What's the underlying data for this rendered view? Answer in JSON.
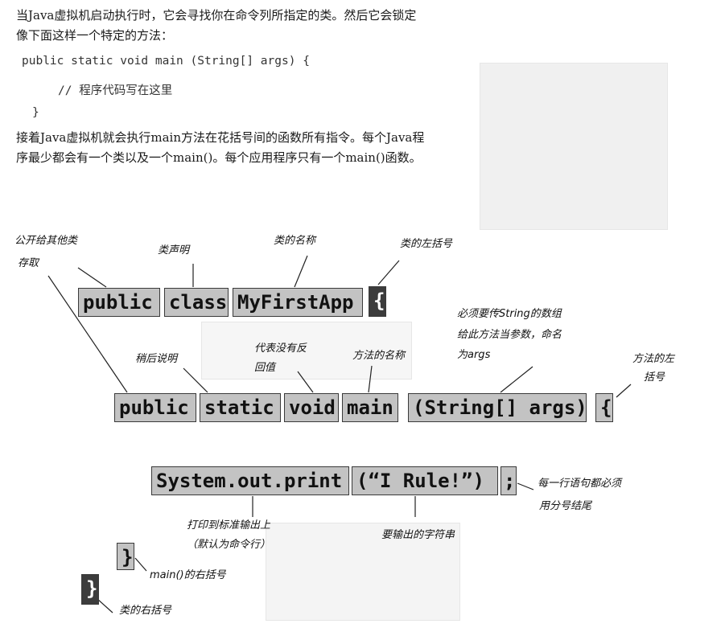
{
  "intro": {
    "line1": "当Java虚拟机启动执行时，它会寻找你在命令列所指定的类。然后它会锁定",
    "line2": "像下面这样一个特定的方法："
  },
  "code_sample": {
    "line1": "public static void main (String[] args) {",
    "line2": "// 程序代码写在这里",
    "line3": "}"
  },
  "outro": {
    "line1": "接着Java虚拟机就会执行main方法在花括号间的函数所有指令。每个Java程",
    "line2": "序最少都会有一个类以及一个main()。每个应用程序只有一个main()函数。"
  },
  "diagram": {
    "class_line": {
      "public": "public",
      "class": "class",
      "name": "MyFirstApp",
      "brace": "{"
    },
    "method_line": {
      "public": "public",
      "static": "static",
      "void": "void",
      "main": "main",
      "args": "(String[] args)",
      "brace": "{"
    },
    "statement_line": {
      "call": "System.out.print",
      "string": "(“I Rule!”)",
      "semicolon": ";"
    },
    "closing": {
      "main_brace": "}",
      "class_brace": "}"
    }
  },
  "annotations": {
    "public_access_1": "公开给其他类",
    "public_access_2": "存取",
    "class_decl": "类声明",
    "class_name": "类的名称",
    "class_left_brace": "类的左括号",
    "must_pass_1": "必须要传String的数组",
    "must_pass_2": "给此方法当参数，命名",
    "must_pass_3": "为args",
    "explain_later": "稍后说明",
    "no_return_1": "代表没有反",
    "no_return_2": "回值",
    "method_name": "方法的名称",
    "method_left_brace_1": "方法的左",
    "method_left_brace_2": "括号",
    "semicolon_note_1": "每一行语句都必须",
    "semicolon_note_2": "用分号结尾",
    "print_note_1": "打印到标准输出上",
    "print_note_2": "（默认为命令行）",
    "string_note": "要输出的字符串",
    "main_right_brace": "main()的右括号",
    "class_right_brace": "类的右括号"
  }
}
